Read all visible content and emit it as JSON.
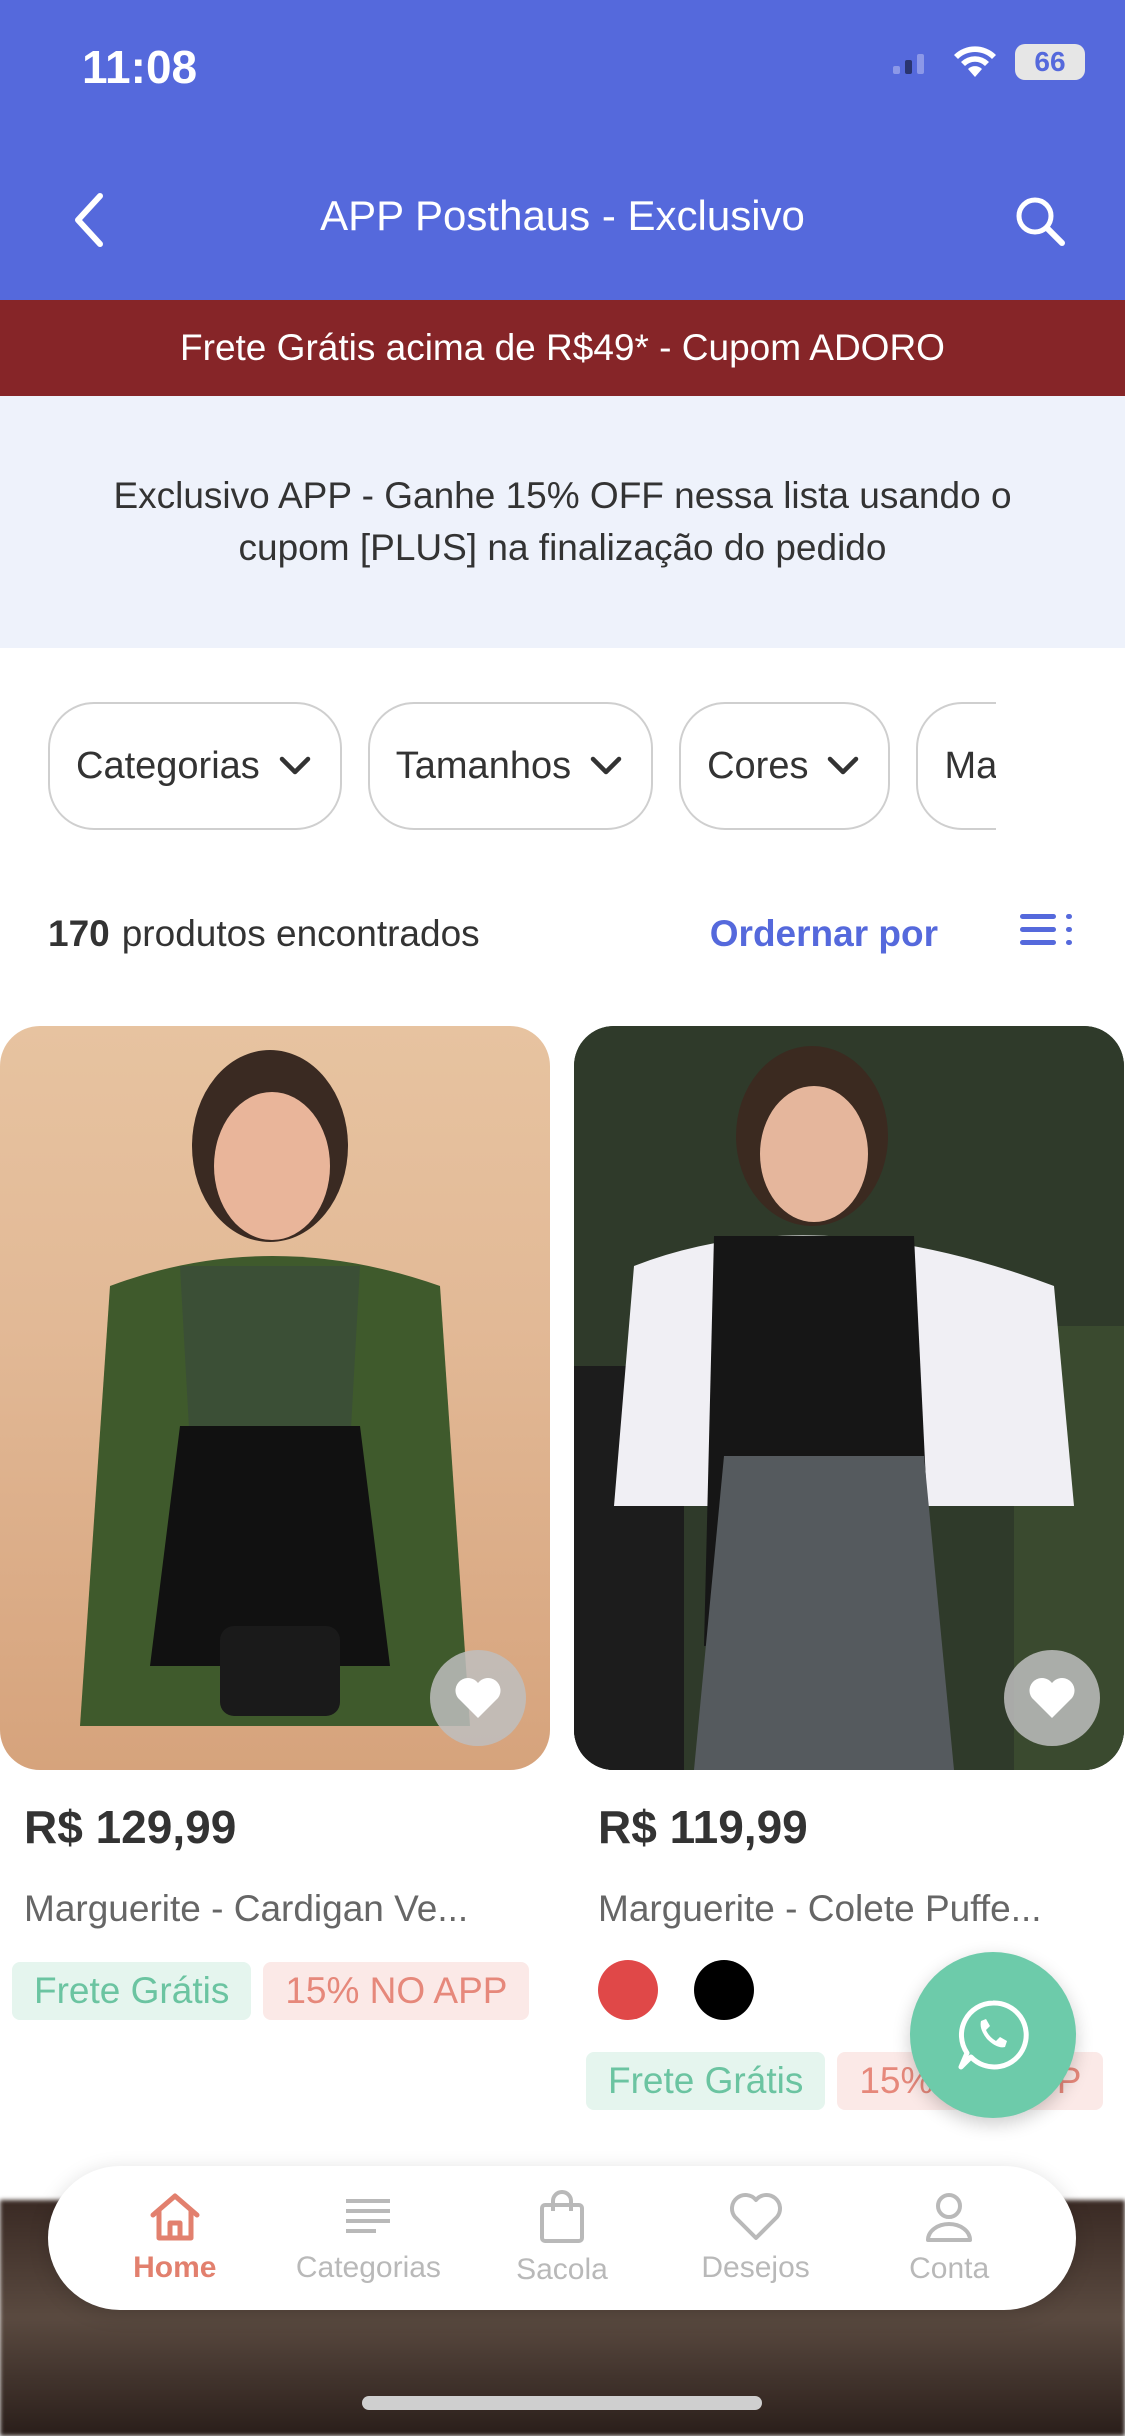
{
  "status_bar": {
    "time": "11:08",
    "battery": "66"
  },
  "header": {
    "title": "APP Posthaus - Exclusivo"
  },
  "promo_strip": {
    "text": "Frete Grátis acima de R$49* - Cupom ADORO"
  },
  "info_box": {
    "text": "Exclusivo APP - Ganhe 15% OFF nessa lista usando o cupom [PLUS] na finalização do pedido"
  },
  "filters": [
    {
      "label": "Categorias"
    },
    {
      "label": "Tamanhos"
    },
    {
      "label": "Cores"
    },
    {
      "label": "Marc"
    }
  ],
  "results": {
    "count": "170",
    "label": "produtos encontrados",
    "sort_label": "Ordernar por"
  },
  "products": [
    {
      "price": "R$ 129,99",
      "name": "Marguerite - Cardigan Ve...",
      "tag_free": "Frete Grátis",
      "tag_app": "15% NO APP"
    },
    {
      "price": "R$ 119,99",
      "name": "Marguerite - Colete Puffe...",
      "tag_free": "Frete Grátis",
      "tag_app": "15% NO APP",
      "colors": [
        "#e04848",
        "#000000"
      ]
    }
  ],
  "bottom_nav": [
    {
      "label": "Home",
      "icon": "home-icon",
      "active": true
    },
    {
      "label": "Categorias",
      "icon": "list-icon",
      "active": false
    },
    {
      "label": "Sacola",
      "icon": "bag-icon",
      "active": false
    },
    {
      "label": "Desejos",
      "icon": "heart-icon",
      "active": false
    },
    {
      "label": "Conta",
      "icon": "user-icon",
      "active": false
    }
  ],
  "colors": {
    "primary": "#5569dc",
    "promo": "#862528",
    "accent": "#e2806e",
    "whatsapp": "#6dcbaa"
  }
}
